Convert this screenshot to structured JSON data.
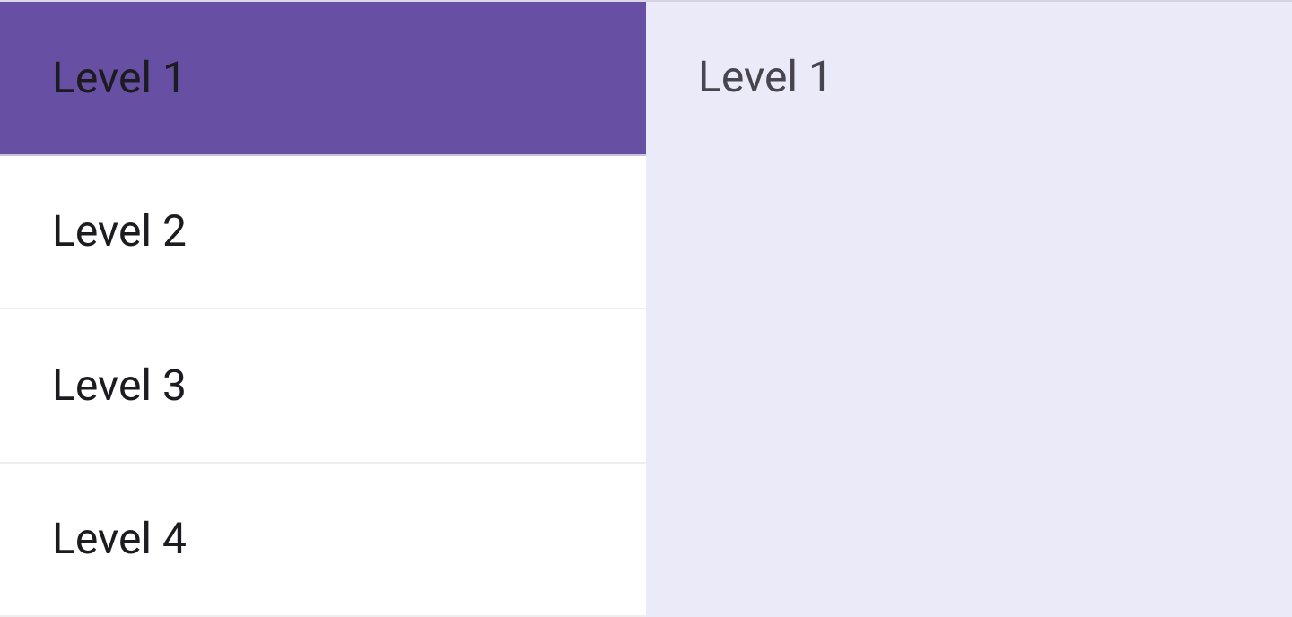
{
  "levels": {
    "items": [
      {
        "label": "Level 1",
        "selected": true
      },
      {
        "label": "Level 2",
        "selected": false
      },
      {
        "label": "Level 3",
        "selected": false
      },
      {
        "label": "Level 4",
        "selected": false
      }
    ]
  },
  "detail": {
    "title": "Level 1"
  },
  "colors": {
    "accent": "#6750A4",
    "detail_bg": "#EBEAF8",
    "text_primary": "#1C1B1F",
    "text_secondary": "#49454F"
  }
}
